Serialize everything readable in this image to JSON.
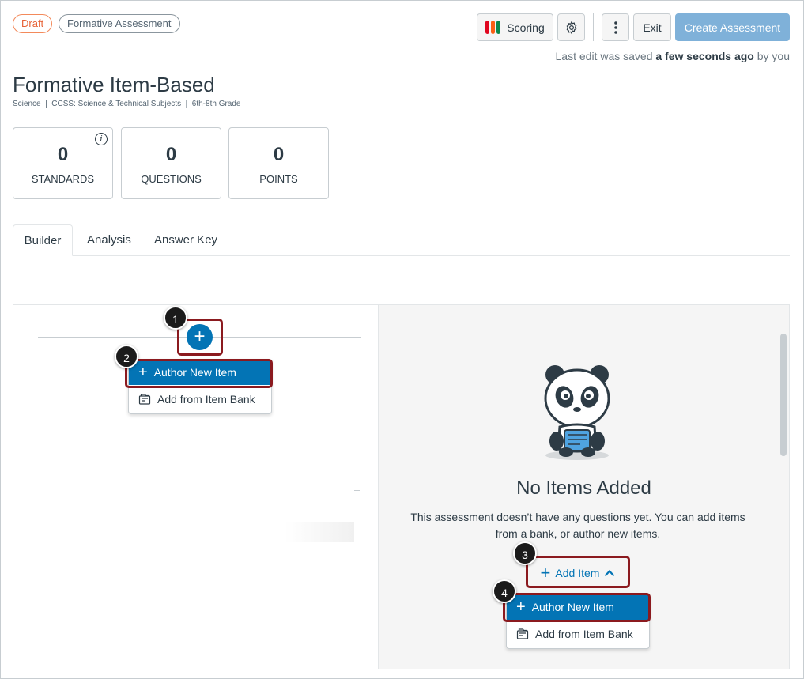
{
  "header": {
    "status_pill": "Draft",
    "type_pill": "Formative Assessment",
    "scoring_label": "Scoring",
    "exit_label": "Exit",
    "create_label": "Create Assessment",
    "saved_prefix": "Last edit was saved",
    "saved_time": "a few seconds ago",
    "saved_suffix": "by you",
    "scoring_colors": [
      "#e0061f",
      "#fc5e13",
      "#0b874b"
    ]
  },
  "assessment": {
    "title": "Formative Item-Based",
    "meta": "Science  |  CCSS: Science & Technical Subjects  |  6th-8th Grade"
  },
  "stats": [
    {
      "value": "0",
      "label": "STANDARDS"
    },
    {
      "value": "0",
      "label": "QUESTIONS"
    },
    {
      "value": "0",
      "label": "POINTS"
    }
  ],
  "tabs": [
    {
      "label": "Builder",
      "active": true
    },
    {
      "label": "Analysis",
      "active": false
    },
    {
      "label": "Answer Key",
      "active": false
    }
  ],
  "builder": {
    "menu_items": [
      {
        "label": "Author New Item",
        "icon": "plus-icon"
      },
      {
        "label": "Add from Item Bank",
        "icon": "item-bank-icon"
      }
    ],
    "callouts": [
      "1",
      "2",
      "3",
      "4"
    ]
  },
  "empty_state": {
    "title": "No Items Added",
    "text": "This assessment doesn’t have any questions yet. You can add items from a bank, or author new items.",
    "add_item_label": "Add Item"
  },
  "colors": {
    "accent": "#0374b5",
    "callout_border": "#8b1a1f",
    "draft": "#e66135"
  }
}
